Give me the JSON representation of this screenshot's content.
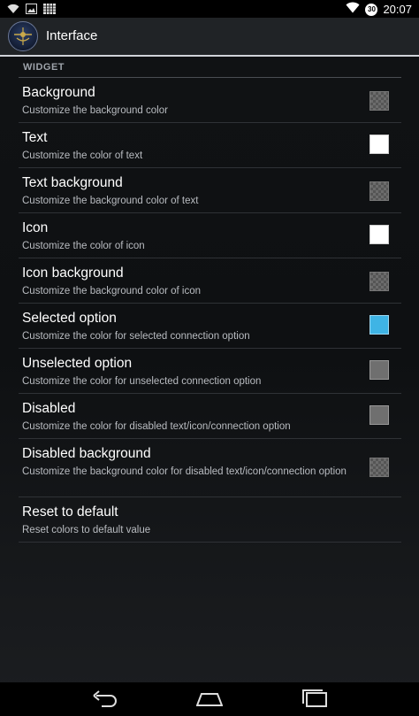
{
  "status_bar": {
    "time": "20:07",
    "alarm": "30"
  },
  "action_bar": {
    "title": "Interface"
  },
  "section": {
    "header": "WIDGET"
  },
  "rows": [
    {
      "title": "Background",
      "subtitle": "Customize the background color",
      "swatch": "transparent"
    },
    {
      "title": "Text",
      "subtitle": "Customize the color of text",
      "swatch": "#ffffff"
    },
    {
      "title": "Text background",
      "subtitle": "Customize the background color of text",
      "swatch": "transparent"
    },
    {
      "title": "Icon",
      "subtitle": "Customize the color of icon",
      "swatch": "#ffffff"
    },
    {
      "title": "Icon background",
      "subtitle": "Customize the background color of icon",
      "swatch": "transparent"
    },
    {
      "title": "Selected option",
      "subtitle": "Customize the color for selected connection option",
      "swatch": "#3fb4e5"
    },
    {
      "title": "Unselected option",
      "subtitle": "Customize the color for unselected connection option",
      "swatch": "#6f6f6f"
    },
    {
      "title": "Disabled",
      "subtitle": "Customize the color for disabled text/icon/connection option",
      "swatch": "#6f6f6f"
    },
    {
      "title": "Disabled background",
      "subtitle": "Customize the background color for disabled text/icon/connection option",
      "swatch": "transparent"
    },
    {
      "title": "Reset to default",
      "subtitle": "Reset colors to default value"
    }
  ],
  "icons": {
    "status_left": [
      "wifi-icon",
      "picture-icon",
      "grid-icon"
    ],
    "status_right": [
      "wifi-signal-icon",
      "alarm-icon"
    ],
    "nav": [
      "back-icon",
      "home-icon",
      "recents-icon"
    ]
  }
}
